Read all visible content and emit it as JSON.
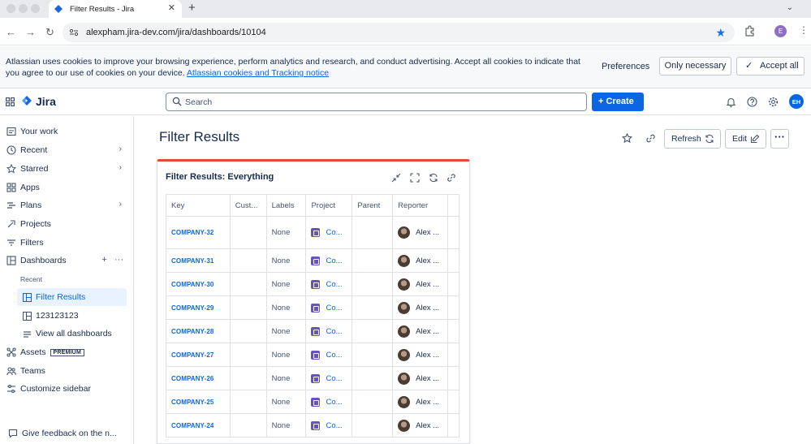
{
  "browser": {
    "tab_title": "Filter Results - Jira",
    "url": "alexpham.jira-dev.com/jira/dashboards/10104",
    "profile_initial": "E"
  },
  "cookie": {
    "text": "Atlassian uses cookies to improve your browsing experience, perform analytics and research, and conduct advertising. Accept all cookies to indicate that you agree to our use of cookies on your device.",
    "link": "Atlassian cookies and Tracking notice",
    "preferences": "Preferences",
    "only_necessary": "Only necessary",
    "accept_all": "Accept all"
  },
  "topnav": {
    "product": "Jira",
    "search_placeholder": "Search",
    "create": "Create",
    "avatar": "EH"
  },
  "sidebar": {
    "your_work": "Your work",
    "recent": "Recent",
    "starred": "Starred",
    "apps": "Apps",
    "plans": "Plans",
    "projects": "Projects",
    "filters": "Filters",
    "dashboards": "Dashboards",
    "recent_label": "Recent",
    "dash_items": [
      "Filter Results",
      "123123123"
    ],
    "view_all": "View all dashboards",
    "assets": "Assets",
    "premium": "PREMIUM",
    "teams": "Teams",
    "customize": "Customize sidebar",
    "feedback": "Give feedback on the n..."
  },
  "main": {
    "title": "Filter Results",
    "refresh": "Refresh",
    "edit": "Edit",
    "more": "···"
  },
  "gadget": {
    "title": "Filter Results: Everything",
    "columns": [
      "Key",
      "Cust...",
      "Labels",
      "Project",
      "Parent",
      "Reporter"
    ],
    "rows": [
      {
        "key": "COMPANY-32",
        "labels": "None",
        "project": "Co...",
        "reporter": "Alex ..."
      },
      {
        "key": "COMPANY-31",
        "labels": "None",
        "project": "Co...",
        "reporter": "Alex ..."
      },
      {
        "key": "COMPANY-30",
        "labels": "None",
        "project": "Co...",
        "reporter": "Alex ..."
      },
      {
        "key": "COMPANY-29",
        "labels": "None",
        "project": "Co...",
        "reporter": "Alex ..."
      },
      {
        "key": "COMPANY-28",
        "labels": "None",
        "project": "Co...",
        "reporter": "Alex ..."
      },
      {
        "key": "COMPANY-27",
        "labels": "None",
        "project": "Co...",
        "reporter": "Alex ..."
      },
      {
        "key": "COMPANY-26",
        "labels": "None",
        "project": "Co...",
        "reporter": "Alex ..."
      },
      {
        "key": "COMPANY-25",
        "labels": "None",
        "project": "Co...",
        "reporter": "Alex ..."
      },
      {
        "key": "COMPANY-24",
        "labels": "None",
        "project": "Co...",
        "reporter": "Alex ..."
      }
    ]
  }
}
